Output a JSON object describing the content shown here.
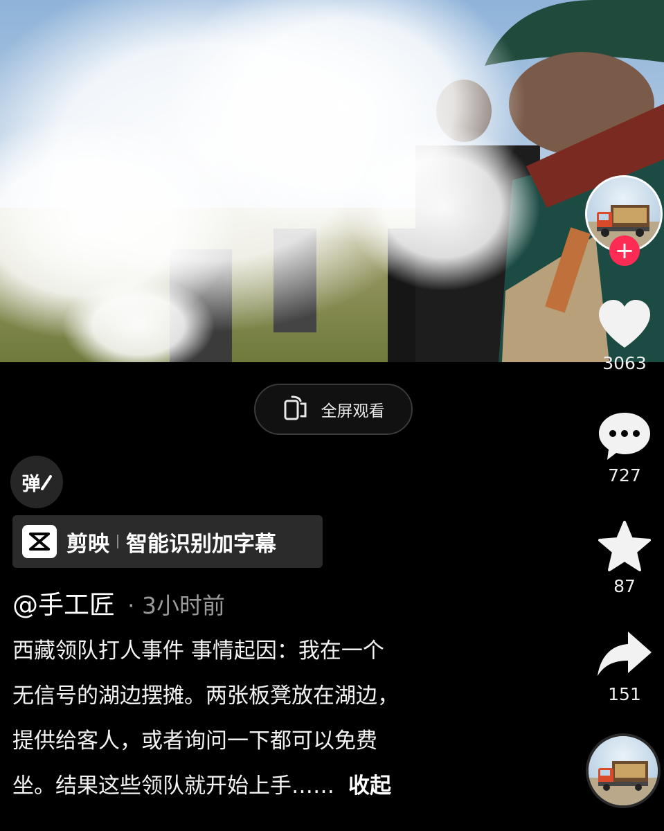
{
  "fullscreen": {
    "label": "全屏观看"
  },
  "danmaku": {
    "label": "弹"
  },
  "capcut": {
    "name": "剪映",
    "slogan": "智能识别加字幕"
  },
  "post": {
    "author": "@手工匠",
    "time": "· 3小时前",
    "caption_lines": [
      "西藏领队打人事件 事情起因：我在一个",
      "无信号的湖边摆摊。两张板凳放在湖边，",
      "提供给客人，或者询问一下都可以免费",
      "坐。结果这些领队就开始上手……"
    ],
    "collapse_label": "收起"
  },
  "actions": {
    "likes": "3063",
    "comments": "727",
    "favorites": "87",
    "shares": "151"
  },
  "colors": {
    "background": "#000000",
    "follow_badge": "#fe2c55",
    "muted_text": "#9a9a9a",
    "banner_bg": "#2b2b2b"
  }
}
